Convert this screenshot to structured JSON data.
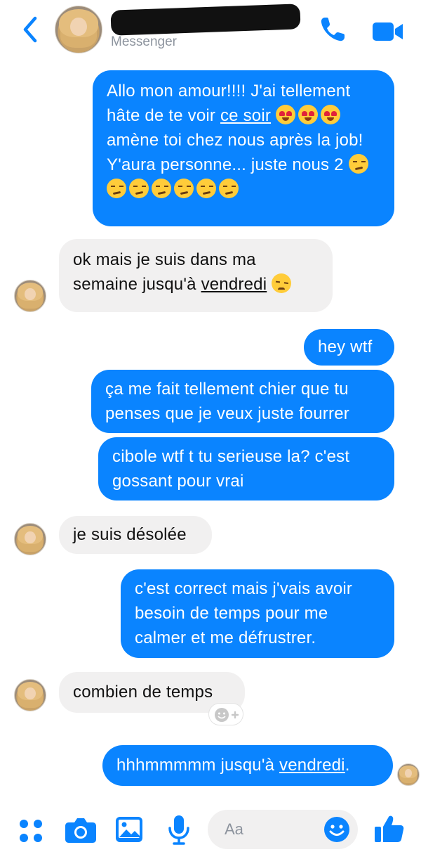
{
  "header": {
    "subtitle": "Messenger",
    "icons": {
      "back": "chevron-left-icon",
      "call": "phone-icon",
      "video": "video-camera-icon"
    }
  },
  "messages": [
    {
      "from": "me",
      "parts": [
        "Allo mon amour!!!! J'ai tellement hâte de te voir ",
        "ce soir",
        " amène toi chez nous après la job! Y'aura personne... juste nous 2"
      ]
    },
    {
      "from": "them",
      "parts": [
        "ok mais je suis dans ma semaine jusqu'à ",
        "vendredi"
      ]
    },
    {
      "from": "me",
      "text": "hey wtf"
    },
    {
      "from": "me",
      "text": "ça me fait tellement chier que tu penses que je veux juste fourrer"
    },
    {
      "from": "me",
      "text": "cibole wtf t tu serieuse la? c'est gossant pour vrai"
    },
    {
      "from": "them",
      "text": "je suis désolée"
    },
    {
      "from": "me",
      "text": "c'est correct mais j'vais avoir besoin de temps pour me calmer et me défrustrer."
    },
    {
      "from": "them",
      "text": "combien de temps"
    },
    {
      "from": "me",
      "parts": [
        "hhhmmmmm jusqu'à ",
        "vendredi",
        "."
      ]
    }
  ],
  "composer": {
    "placeholder": "Aa",
    "icons": [
      "apps-icon",
      "camera-icon",
      "image-icon",
      "microphone-icon",
      "emoji-icon",
      "thumbs-up-icon"
    ]
  },
  "colors": {
    "accent": "#0a84ff",
    "incoming_bubble": "#f1f0f0"
  }
}
